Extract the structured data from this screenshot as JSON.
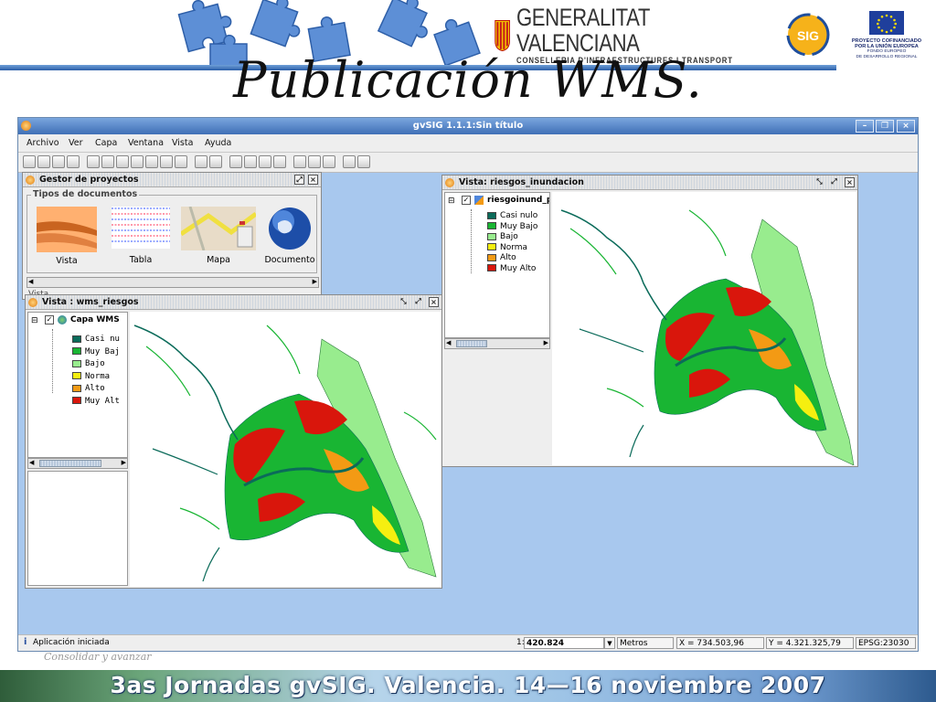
{
  "slide": {
    "title": "Publicación WMS.",
    "footer_text": "3as Jornadas gvSIG. Valencia. 14—16 noviembre 2007",
    "slogan": "Consolidar y avanzar",
    "logo_name": "GENERALITAT VALENCIANA",
    "logo_sub": "CONSELLERIA D'INFRAESTRUCTURES I TRANSPORT",
    "gvsig_logo_text": "SIG",
    "eu_lines": [
      "PROYECTO COFINANCIADO",
      "POR LA UNIÓN EUROPEA",
      "FONDO EUROPEO",
      "DE DESARROLLO REGIONAL"
    ]
  },
  "app": {
    "window_title": "gvSIG 1.1.1:Sin título",
    "menus": [
      "Archivo",
      "Ver",
      "Capa",
      "Ventana",
      "Vista",
      "Ayuda"
    ],
    "toolbar_icons": [
      "new-icon",
      "open-icon",
      "save-icon",
      "layer-add-icon",
      "zoom-in-icon",
      "zoom-out-icon",
      "zoom-prev-icon",
      "layers-icon",
      "zoom-full-icon",
      "zoom-select-icon",
      "eraser-icon",
      "pan-icon",
      "layers2-icon",
      "info-icon",
      "query-icon",
      "measure-icon",
      "walk-icon",
      "select-box-icon",
      "gray-icon",
      "polygon-icon",
      "grid-icon",
      "tools-icon"
    ],
    "status": {
      "message": "Aplicación iniciada",
      "scale_prefix": "1:",
      "scale_value": "420.824",
      "units": "Metros",
      "x_coord": "X = 734.503,96",
      "y_coord": "Y = 4.321.325,79",
      "epsg": "EPSG:23030"
    }
  },
  "project_manager": {
    "title": "Gestor de proyectos",
    "group_label": "Tipos de documentos",
    "doc_types": [
      "Vista",
      "Tabla",
      "Mapa",
      "Documento"
    ],
    "section_label": "Vista"
  },
  "view_wms": {
    "title": "Vista : wms_riesgos",
    "layer_name": "Capa WMS",
    "legend": [
      {
        "label": "Casi nu",
        "color": "#0b6b5a"
      },
      {
        "label": "Muy Baj",
        "color": "#19b533"
      },
      {
        "label": "Bajo",
        "color": "#98ec8e"
      },
      {
        "label": "Norma",
        "color": "#f5ef10"
      },
      {
        "label": "Alto",
        "color": "#f39a14"
      },
      {
        "label": "Muy Alt",
        "color": "#d9160c"
      }
    ]
  },
  "view_inund": {
    "title": "Vista: riesgos_inundacion",
    "layer_name": "riesgoinund_p",
    "legend": [
      {
        "label": "Casi nulo",
        "color": "#0b6b5a"
      },
      {
        "label": "Muy Bajo",
        "color": "#19b533"
      },
      {
        "label": "Bajo",
        "color": "#98ec8e"
      },
      {
        "label": "Norma",
        "color": "#f5ef10"
      },
      {
        "label": "Alto",
        "color": "#f39a14"
      },
      {
        "label": "Muy Alto",
        "color": "#d9160c"
      }
    ]
  },
  "colors": {
    "casi_nulo": "#0b6b5a",
    "muy_bajo": "#19b533",
    "bajo": "#98ec8e",
    "norma": "#f5ef10",
    "alto": "#f39a14",
    "muy_alto": "#d9160c",
    "desktop": "#a8c8ee"
  }
}
